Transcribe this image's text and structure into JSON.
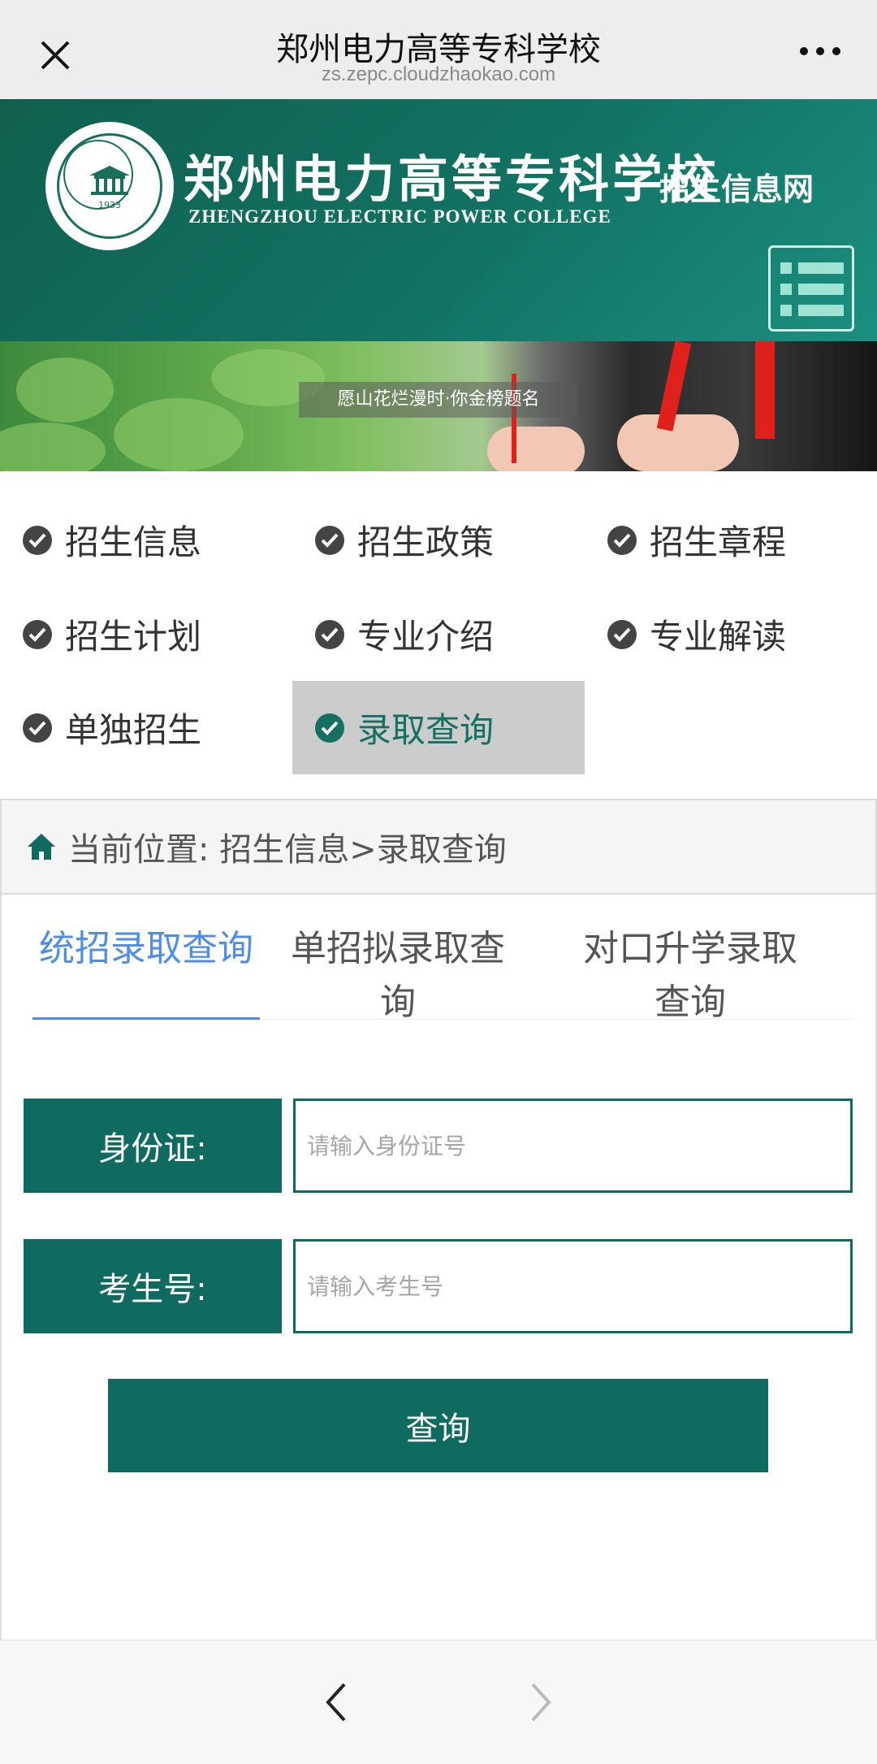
{
  "browser": {
    "title": "郑州电力高等专科学校",
    "url": "zs.zepc.cloudzhaokao.com",
    "close_icon": "close-icon",
    "more_icon": "more-icon"
  },
  "header": {
    "school_name_cn": "郑州电力高等专科学校",
    "school_name_en": "ZHENGZHOU ELECTRIC POWER COLLEGE",
    "logo_year": "1933",
    "site_name": "招生信息网",
    "menu_icon": "list-menu-icon"
  },
  "banner": {
    "slogan": "愿山花烂漫时·你金榜题名"
  },
  "categories": [
    {
      "label": "招生信息",
      "active": false
    },
    {
      "label": "招生政策",
      "active": false
    },
    {
      "label": "招生章程",
      "active": false
    },
    {
      "label": "招生计划",
      "active": false
    },
    {
      "label": "专业介绍",
      "active": false
    },
    {
      "label": "专业解读",
      "active": false
    },
    {
      "label": "单独招生",
      "active": false
    },
    {
      "label": "录取查询",
      "active": true
    }
  ],
  "breadcrumb": {
    "text": "当前位置: 招生信息>录取查询"
  },
  "tabs": [
    {
      "label": "统招录取查询",
      "active": true
    },
    {
      "label": "单招拟录取查询",
      "active": false
    },
    {
      "label": "对口升学录取查询",
      "active": false
    }
  ],
  "form": {
    "id_label": "身份证:",
    "id_placeholder": "请输入身份证号",
    "exam_label": "考生号:",
    "exam_placeholder": "请输入考生号",
    "submit_label": "查询"
  },
  "colors": {
    "brand_green": "#0f6b60",
    "tab_active": "#4f8de6",
    "active_item_bg": "#cccccc"
  }
}
